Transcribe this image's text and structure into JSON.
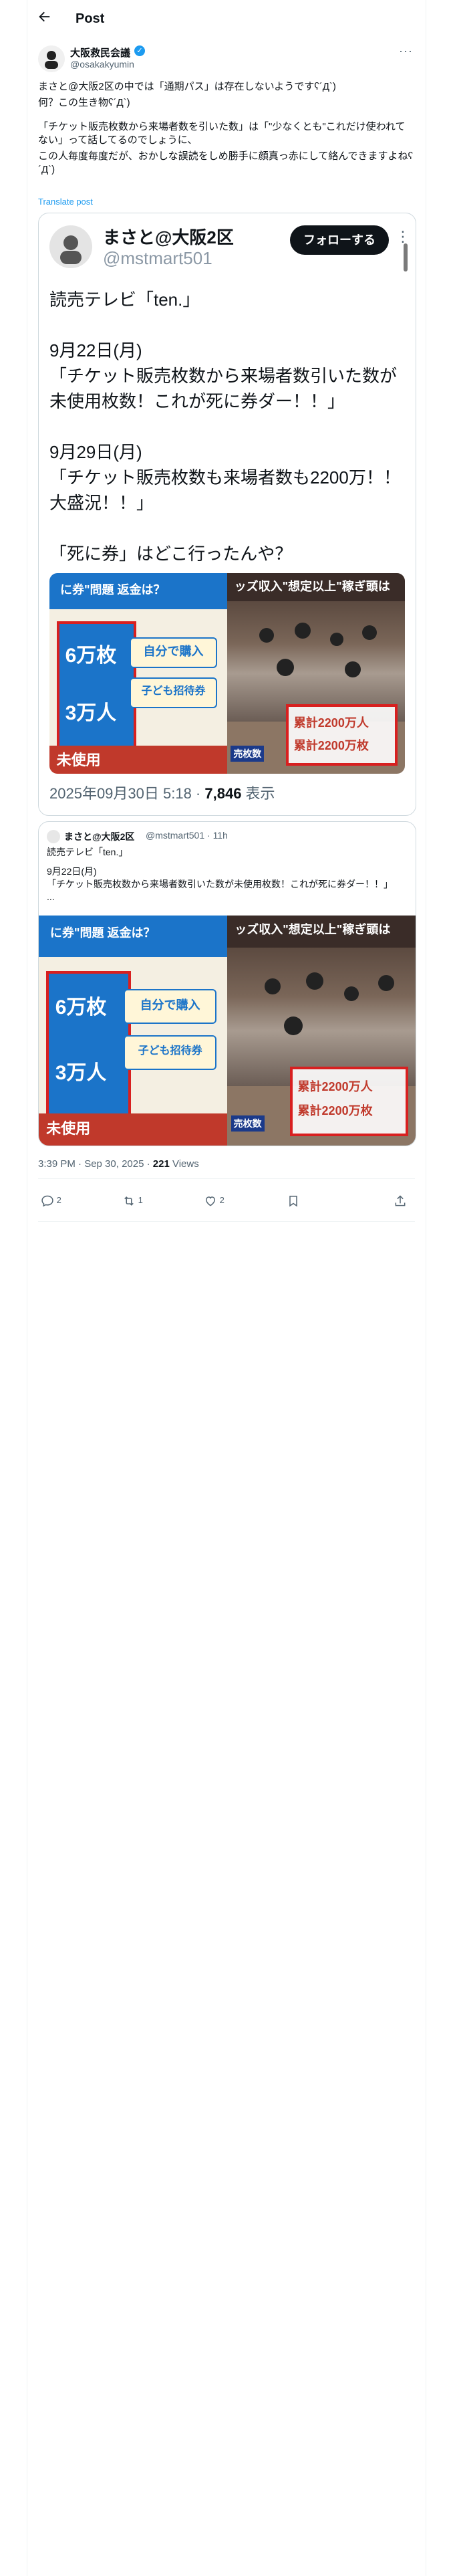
{
  "header": {
    "back_icon": "arrow-left-icon",
    "title": "Post"
  },
  "author": {
    "name": "大阪救民会議",
    "handle": "@osakakyumin",
    "verified_color": "#1d9bf0"
  },
  "post": {
    "line1": "まさと@大阪2区の中では「通期パス」は存在しないようですʕ´Д`)",
    "line2": "何？この生き物ʕ´Д`)",
    "line3": "「チケット販売枚数から来場者数を引いた数」は「\"少なくとも\"これだけ使われてない」って話してるのでしょうに、",
    "line4": "この人毎度毎度だが、おかしな誤読をしめ勝手に顔真っ赤にして絡んできますよねʕ´Д`)",
    "translate": "Translate post"
  },
  "quote_card": {
    "name": "まさと@大阪2区",
    "handle": "@mstmart501",
    "follow_label": "フォローする",
    "lines": [
      "読売テレビ「ten.」",
      "9月22日(月)",
      "「チケット販売枚数から来場者数引いた数が未使用枚数！これが死に券ダー！！」",
      "9月29日(月)",
      "「チケット販売枚数も来場者数も2200万！！大盛況！！」",
      "「死に券」はどこ行ったんや？"
    ],
    "date": "2025年09月30日 5:18 · ",
    "views_num": "7,846",
    "views_label": " 表示",
    "image_left": {
      "banner": "に券\"問題  返金は？",
      "num1": "6万枚",
      "num2": "3万人",
      "opt1": "自分で購入",
      "opt2": "子ども招待券",
      "bottom": "未使用"
    },
    "image_right": {
      "banner": "ッズ収入\"想定以上\"稼ぎ頭は",
      "stat1": "累計2200万人",
      "stat2": "累計2200万枚",
      "side": "売枚数"
    }
  },
  "quoted_tweet": {
    "name": "まさと@大阪2区",
    "meta": "@mstmart501 · 11h",
    "line1": "読売テレビ「ten.」",
    "line2": "9月22日(月)",
    "line3": "「チケット販売枚数から来場者数引いた数が未使用枚数！これが死に券ダー！！」",
    "line4": "..."
  },
  "timestamp": {
    "time": "3:39 PM · Sep 30, 2025 · ",
    "views_num": "221",
    "views_label": " Views"
  },
  "actions": [
    {
      "icon": "reply-icon",
      "count": "2"
    },
    {
      "icon": "repost-icon",
      "count": "1"
    },
    {
      "icon": "like-icon",
      "count": "2"
    },
    {
      "icon": "bookmark-icon",
      "count": ""
    },
    {
      "icon": "share-icon",
      "count": ""
    }
  ]
}
